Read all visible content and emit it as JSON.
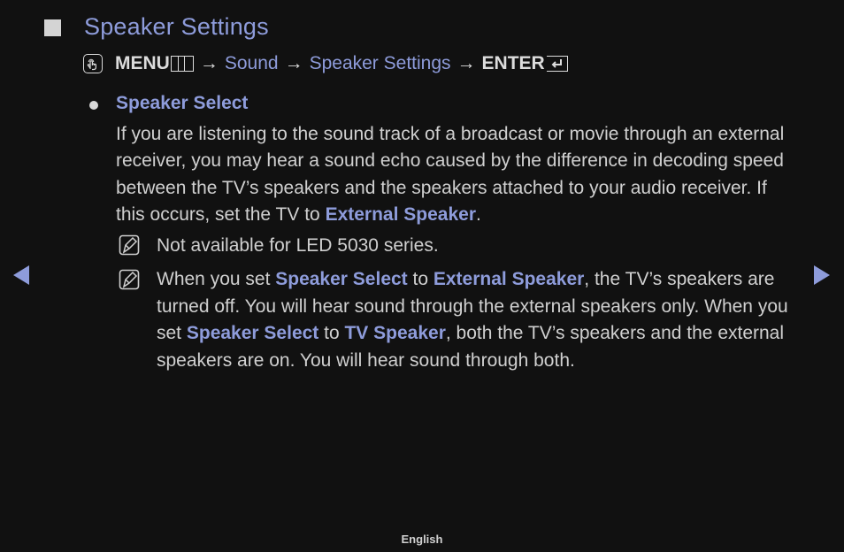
{
  "header": {
    "title": "Speaker Settings"
  },
  "path": {
    "menu_label": "MENU",
    "arrow": "→",
    "crumbs": [
      "Sound",
      "Speaker Settings"
    ],
    "enter_label": "ENTER"
  },
  "section": {
    "title": "Speaker Select",
    "para_text": "If you are listening to the sound track of a broadcast or movie through an external receiver, you may hear a sound echo caused by the difference in decoding speed between the TV’s speakers and the speakers attached to your audio receiver. If this occurs, set the TV to ",
    "para_highlight": "External Speaker",
    "para_end": "."
  },
  "notes": [
    {
      "text": "Not available for LED 5030 series."
    },
    {
      "p1": "When you set ",
      "h1": "Speaker Select",
      "p2": " to ",
      "h2": "External Speaker",
      "p3": ", the TV’s speakers are turned off. You will hear sound through the external speakers only. When you set ",
      "h3": "Speaker Select",
      "p4": " to ",
      "h4": "TV Speaker",
      "p5": ", both the TV’s speakers and the external speakers are on. You will hear sound through both."
    }
  ],
  "nav": {
    "prev_icon": "triangle-left-icon",
    "next_icon": "triangle-right-icon"
  },
  "footer": {
    "language": "English"
  },
  "colors": {
    "accent": "#8e9cdb",
    "text": "#d0d0d0",
    "background": "#111111"
  }
}
